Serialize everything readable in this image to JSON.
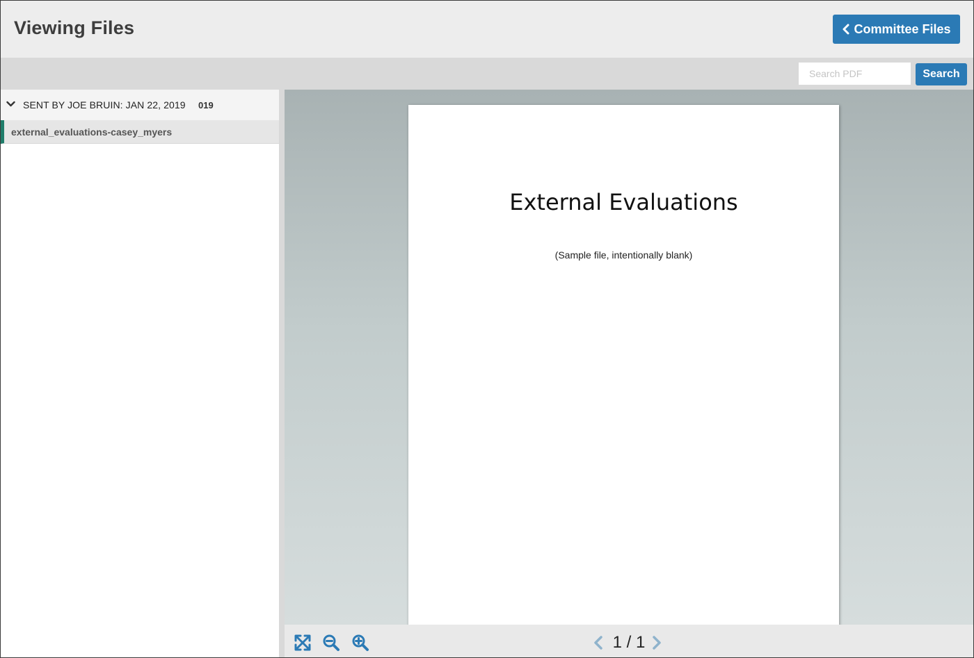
{
  "header": {
    "title": "Viewing Files",
    "back_button_label": "Committee Files"
  },
  "toolbar": {
    "search_placeholder": "Search PDF",
    "search_value": "",
    "search_button_label": "Search"
  },
  "sidebar": {
    "group": {
      "label": "SENT BY JOE BRUIN: JAN 22, 2019",
      "count": "019",
      "expanded": true
    },
    "files": [
      {
        "label": "external_evaluations-casey_myers",
        "selected": true
      }
    ]
  },
  "document": {
    "heading": "External Evaluations",
    "subtext": "(Sample file, intentionally blank)"
  },
  "viewer_controls": {
    "page_indicator": "1 / 1",
    "current_page": 1,
    "total_pages": 1,
    "icons": [
      "fullscreen-icon",
      "zoom-out-icon",
      "zoom-in-icon",
      "chevron-left-icon",
      "chevron-right-icon"
    ]
  },
  "colors": {
    "accent": "#2b7ab5",
    "selected_marker": "#1f7d6a",
    "header_bg": "#ededed",
    "toolbar_bg": "#d9d9d9",
    "pager_arrow": "#8fb3cc"
  }
}
